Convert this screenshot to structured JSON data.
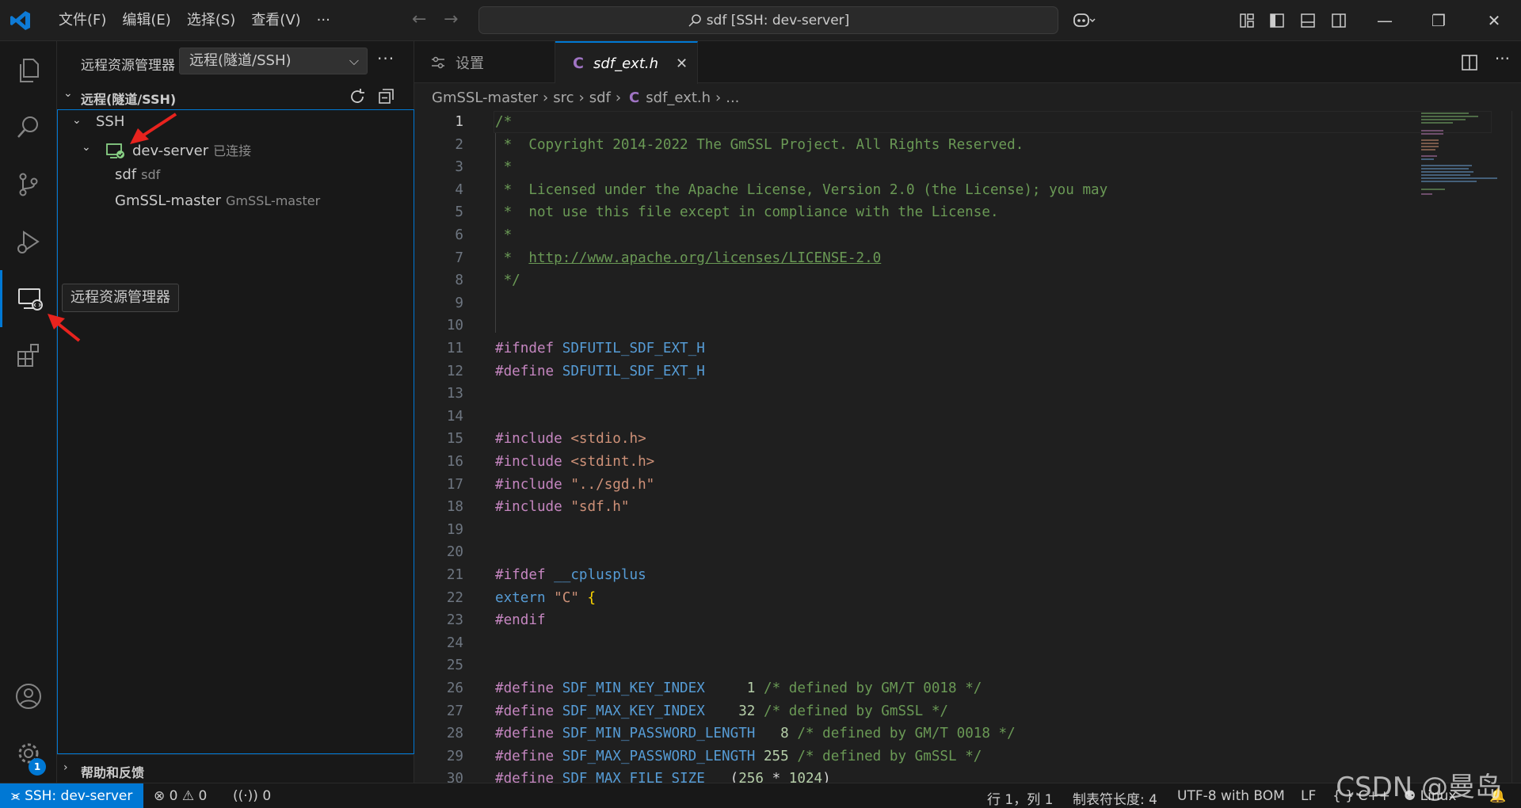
{
  "titlebar": {
    "menu": [
      "文件(F)",
      "编辑(E)",
      "选择(S)",
      "查看(V)",
      "···"
    ],
    "command_center": "sdf [SSH: dev-server]"
  },
  "activity": {
    "tooltip": "远程资源管理器",
    "badge": "1"
  },
  "sidebar": {
    "title": "远程资源管理器",
    "select_value": "远程(隧道/SSH)",
    "more": "···",
    "section_label": "远程(隧道/SSH)",
    "tree": {
      "group": "SSH",
      "host": "dev-server",
      "host_status": "已连接",
      "items": [
        {
          "label": "sdf",
          "desc": "sdf"
        },
        {
          "label": "GmSSL-master",
          "desc": "GmSSL-master"
        }
      ]
    },
    "footer_label": "帮助和反馈"
  },
  "editor": {
    "tabs": [
      {
        "label": "设置",
        "icon": "settings-icon"
      },
      {
        "label": "sdf_ext.h",
        "icon": "c-file-icon"
      }
    ],
    "breadcrumbs": [
      "GmSSL-master",
      "src",
      "sdf",
      "sdf_ext.h",
      "..."
    ],
    "file_icon_letter": "C",
    "lines": [
      {
        "n": "1",
        "tokens": [
          [
            "com",
            "/*"
          ]
        ]
      },
      {
        "n": "2",
        "tokens": [
          [
            "com",
            " *  Copyright 2014-2022 The GmSSL Project. All Rights Reserved."
          ]
        ]
      },
      {
        "n": "3",
        "tokens": [
          [
            "com",
            " *"
          ]
        ]
      },
      {
        "n": "4",
        "tokens": [
          [
            "com",
            " *  Licensed under the Apache License, Version 2.0 (the License); you may"
          ]
        ]
      },
      {
        "n": "5",
        "tokens": [
          [
            "com",
            " *  not use this file except in compliance with the License."
          ]
        ]
      },
      {
        "n": "6",
        "tokens": [
          [
            "com",
            " *"
          ]
        ]
      },
      {
        "n": "7",
        "tokens": [
          [
            "com",
            " *  "
          ],
          [
            "url",
            "http://www.apache.org/licenses/LICENSE-2.0"
          ]
        ]
      },
      {
        "n": "8",
        "tokens": [
          [
            "com",
            " */"
          ]
        ]
      },
      {
        "n": "9",
        "tokens": []
      },
      {
        "n": "10",
        "tokens": []
      },
      {
        "n": "11",
        "tokens": [
          [
            "pp",
            "#ifndef"
          ],
          [
            "plain",
            " "
          ],
          [
            "mac",
            "SDFUTIL_SDF_EXT_H"
          ]
        ]
      },
      {
        "n": "12",
        "tokens": [
          [
            "pp",
            "#define"
          ],
          [
            "plain",
            " "
          ],
          [
            "mac",
            "SDFUTIL_SDF_EXT_H"
          ]
        ]
      },
      {
        "n": "13",
        "tokens": []
      },
      {
        "n": "14",
        "tokens": []
      },
      {
        "n": "15",
        "tokens": [
          [
            "pp",
            "#include"
          ],
          [
            "plain",
            " "
          ],
          [
            "str",
            "<stdio.h>"
          ]
        ]
      },
      {
        "n": "16",
        "tokens": [
          [
            "pp",
            "#include"
          ],
          [
            "plain",
            " "
          ],
          [
            "str",
            "<stdint.h>"
          ]
        ]
      },
      {
        "n": "17",
        "tokens": [
          [
            "pp",
            "#include"
          ],
          [
            "plain",
            " "
          ],
          [
            "str",
            "\"../sgd.h\""
          ]
        ]
      },
      {
        "n": "18",
        "tokens": [
          [
            "pp",
            "#include"
          ],
          [
            "plain",
            " "
          ],
          [
            "str",
            "\"sdf.h\""
          ]
        ]
      },
      {
        "n": "19",
        "tokens": []
      },
      {
        "n": "20",
        "tokens": []
      },
      {
        "n": "21",
        "tokens": [
          [
            "pp",
            "#ifdef"
          ],
          [
            "plain",
            " "
          ],
          [
            "mac",
            "__cplusplus"
          ]
        ]
      },
      {
        "n": "22",
        "tokens": [
          [
            "kw",
            "extern"
          ],
          [
            "plain",
            " "
          ],
          [
            "str",
            "\"C\""
          ],
          [
            "plain",
            " "
          ],
          [
            "brace",
            "{"
          ]
        ]
      },
      {
        "n": "23",
        "tokens": [
          [
            "pp",
            "#endif"
          ]
        ]
      },
      {
        "n": "24",
        "tokens": []
      },
      {
        "n": "25",
        "tokens": []
      },
      {
        "n": "26",
        "tokens": [
          [
            "pp",
            "#define"
          ],
          [
            "plain",
            " "
          ],
          [
            "mac",
            "SDF_MIN_KEY_INDEX"
          ],
          [
            "plain",
            "     "
          ],
          [
            "num",
            "1"
          ],
          [
            "plain",
            " "
          ],
          [
            "com",
            "/* defined by GM/T 0018 */"
          ]
        ]
      },
      {
        "n": "27",
        "tokens": [
          [
            "pp",
            "#define"
          ],
          [
            "plain",
            " "
          ],
          [
            "mac",
            "SDF_MAX_KEY_INDEX"
          ],
          [
            "plain",
            "    "
          ],
          [
            "num",
            "32"
          ],
          [
            "plain",
            " "
          ],
          [
            "com",
            "/* defined by GmSSL */"
          ]
        ]
      },
      {
        "n": "28",
        "tokens": [
          [
            "pp",
            "#define"
          ],
          [
            "plain",
            " "
          ],
          [
            "mac",
            "SDF_MIN_PASSWORD_LENGTH"
          ],
          [
            "plain",
            "   "
          ],
          [
            "num",
            "8"
          ],
          [
            "plain",
            " "
          ],
          [
            "com",
            "/* defined by GM/T 0018 */"
          ]
        ]
      },
      {
        "n": "29",
        "tokens": [
          [
            "pp",
            "#define"
          ],
          [
            "plain",
            " "
          ],
          [
            "mac",
            "SDF_MAX_PASSWORD_LENGTH"
          ],
          [
            "plain",
            " "
          ],
          [
            "num",
            "255"
          ],
          [
            "plain",
            " "
          ],
          [
            "com",
            "/* defined by GmSSL */"
          ]
        ]
      },
      {
        "n": "30",
        "tokens": [
          [
            "pp",
            "#define"
          ],
          [
            "plain",
            " "
          ],
          [
            "mac",
            "SDF_MAX_FILE_SIZE"
          ],
          [
            "plain",
            "   ("
          ],
          [
            "num",
            "256"
          ],
          [
            "plain",
            " * "
          ],
          [
            "num",
            "1024"
          ],
          [
            "plain",
            ")"
          ]
        ]
      }
    ]
  },
  "statusbar": {
    "remote": "SSH: dev-server",
    "errors": "0",
    "warnings": "0",
    "ports": "0",
    "position": "行 1，列 1",
    "tab_size": "制表符长度: 4",
    "encoding": "UTF-8 with BOM",
    "eol": "LF",
    "language": "C++",
    "platform": "Linux"
  },
  "watermark": "CSDN @曼岛",
  "colors": {
    "accent": "#0078d4",
    "background": "#1f1f1f",
    "sidebar": "#181818",
    "comment": "#6a9955",
    "preprocessor": "#c586c0",
    "macro": "#569cd6",
    "string": "#ce9178",
    "arrow": "#e8231e"
  }
}
